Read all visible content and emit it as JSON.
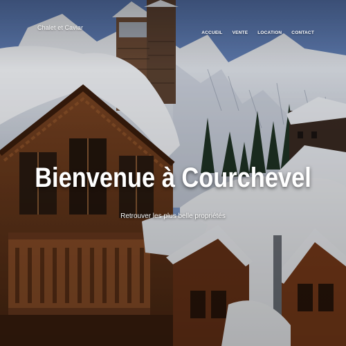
{
  "navbar": {
    "brand": "Chalet et Caviar",
    "links": [
      {
        "label": "ACCUEIL"
      },
      {
        "label": "VENTE"
      },
      {
        "label": "LOCATION"
      },
      {
        "label": "CONTACT"
      }
    ]
  },
  "hero": {
    "title": "Bienvenue à Courchevel",
    "subtitle": "Retrouver les plus belle propriétés",
    "background_image": "snowy-chalet-mountain-photo"
  },
  "colors": {
    "text": "#ffffff",
    "sky": "#6f8fc6",
    "wood": "#6b3a1f",
    "snow": "#f1f3f7"
  }
}
